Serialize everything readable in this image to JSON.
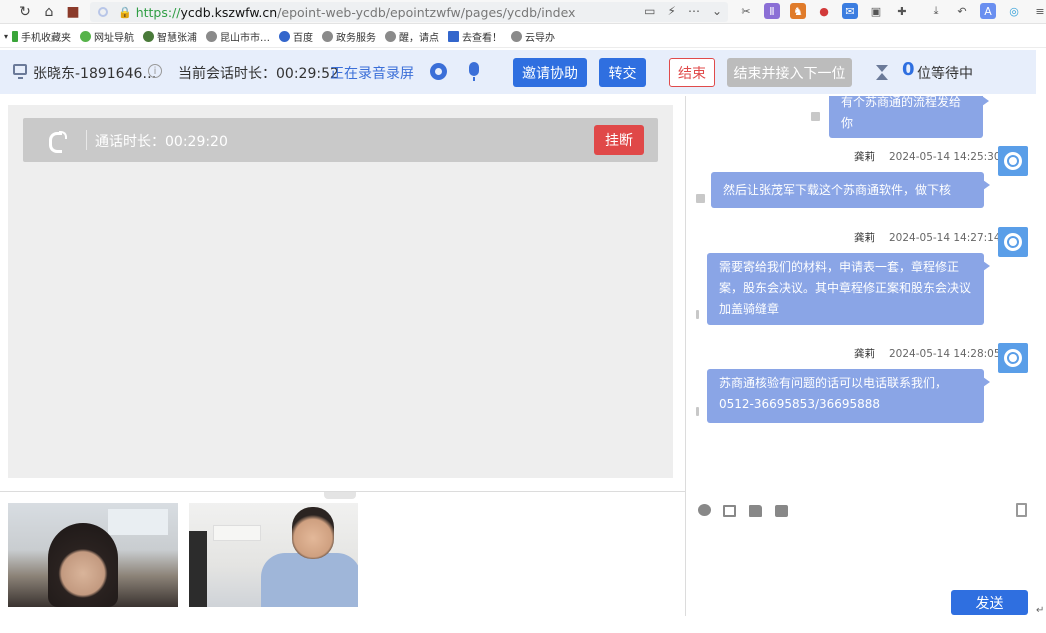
{
  "browser": {
    "url_scheme": "https://",
    "url_domain": "ycdb.kszwfw.cn",
    "url_path": "/epoint-web-ycdb/epointzwfw/pages/ycdb/index"
  },
  "bookmarks": [
    {
      "label": "手机收藏夹",
      "color": "#3aa53a"
    },
    {
      "label": "网址导航",
      "color": "#56b34a"
    },
    {
      "label": "智慧张浦",
      "color": "#4a7a3a"
    },
    {
      "label": "昆山市市…",
      "color": "#8a8a8a"
    },
    {
      "label": "百度",
      "color": "#3366cc"
    },
    {
      "label": "政务服务",
      "color": "#8a8a8a"
    },
    {
      "label": "醒，请点",
      "color": "#8a8a8a"
    },
    {
      "label": "去查看！",
      "color": "#3366cc"
    },
    {
      "label": "云导办",
      "color": "#8a8a8a"
    }
  ],
  "header": {
    "caller": "张晓东-1891646…",
    "duration_label": "当前会话时长：",
    "duration_value": "00:29:52",
    "recording_status": "正在录音录屏",
    "invite_label": "邀请协助",
    "transfer_label": "转交",
    "end_label": "结束",
    "end_next_label": "结束并接入下一位",
    "waiting_count": "0",
    "waiting_label": "位等待中"
  },
  "call": {
    "duration_text": "通话时长：00:29:20",
    "hangup_label": "挂断"
  },
  "chat": {
    "messages": [
      {
        "sender": "",
        "time": "",
        "text": "有个苏商通的流程发给你"
      },
      {
        "sender": "龚莉",
        "time": "2024-05-14 14:25:30",
        "text": "然后让张茂军下载这个苏商通软件，做下核验。"
      },
      {
        "sender": "龚莉",
        "time": "2024-05-14 14:27:14",
        "text": "需要寄给我们的材料，申请表一套，章程修正案，股东会决议。其中章程修正案和股东会决议加盖骑缝章"
      },
      {
        "sender": "龚莉",
        "time": "2024-05-14 14:28:05",
        "text": "苏商通核验有问题的话可以电话联系我们，0512-36695853/36695888"
      }
    ],
    "send_label": "发送",
    "input_value": ""
  },
  "icons": {
    "back": "refresh-icon",
    "home": "home-icon",
    "agent": "agent-avatar-icon"
  },
  "colors": {
    "primary": "#2f6fe0",
    "danger": "#e04848",
    "bubble": "#8aa5e6",
    "header_bg": "#e7eefb"
  }
}
